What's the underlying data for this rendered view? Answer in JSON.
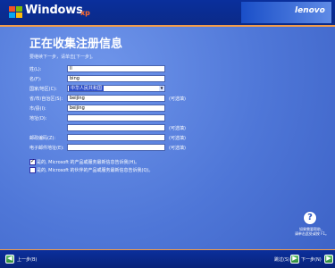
{
  "header": {
    "product": "Windows",
    "edition": "xp",
    "brand": "lenovo"
  },
  "page": {
    "title": "正在收集注册信息",
    "instructions": "要继续下一步，请单击[下一步]。"
  },
  "form": {
    "fields": [
      {
        "label": "姓(L):",
        "value": "ll",
        "optional": ""
      },
      {
        "label": "名(F):",
        "value": "bing",
        "optional": ""
      },
      {
        "label": "国家/地区(C):",
        "value": "中华人民共和国",
        "optional": "",
        "type": "select"
      },
      {
        "label": "省/市/自治区(S):",
        "value": "beijing",
        "optional": "(可选填)"
      },
      {
        "label": "市/县(I):",
        "value": "beijing",
        "optional": ""
      },
      {
        "label": "地址(D):",
        "value": "",
        "optional": ""
      },
      {
        "label": "",
        "value": "",
        "optional": "(可选填)"
      },
      {
        "label": "邮政编码(Z):",
        "value": "",
        "optional": "(可选填)"
      },
      {
        "label": "电子邮件地址(E):",
        "value": "",
        "optional": "(可选填)"
      }
    ],
    "checkboxes": [
      {
        "label": "是的, Microsoft 的产品或服务最新信息告诉我(H)。",
        "checked": true
      },
      {
        "label": "是的, Microsoft 的伙伴的产品或服务最新信息告诉我(Q)。",
        "checked": false
      }
    ]
  },
  "help": {
    "icon": "question-icon",
    "text_line1": "如果需要帮助，",
    "text_line2": "请单击此处或按 F1。"
  },
  "footer": {
    "back_label": "上一步(B)",
    "skip_label": "跳过(S)",
    "next_label": "下一步(N)"
  }
}
